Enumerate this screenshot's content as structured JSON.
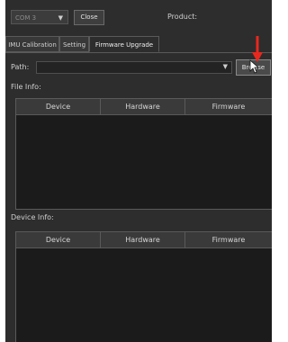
{
  "toolbar": {
    "port_combo_value": "COM 3",
    "close_label": "Close",
    "product_label": "Product:"
  },
  "tabs": [
    {
      "label": "IMU Calibration",
      "active": false
    },
    {
      "label": "Setting",
      "active": false
    },
    {
      "label": "Firmware Upgrade",
      "active": true
    }
  ],
  "firmware": {
    "path_label": "Path:",
    "path_value": "",
    "browse_label": "Browse",
    "file_info_label": "File Info:",
    "device_info_label": "Device Info:"
  },
  "table_headers": [
    "Device",
    "Hardware",
    "Firmware"
  ],
  "icons": {
    "dropdown": "chevron-down-icon",
    "annotation": "red-arrow-icon",
    "pointer": "mouse-cursor-icon"
  },
  "colors": {
    "panel_bg": "#2d2d2d",
    "table_bg": "#1b1b1b",
    "annotation_red": "#e8281e"
  }
}
